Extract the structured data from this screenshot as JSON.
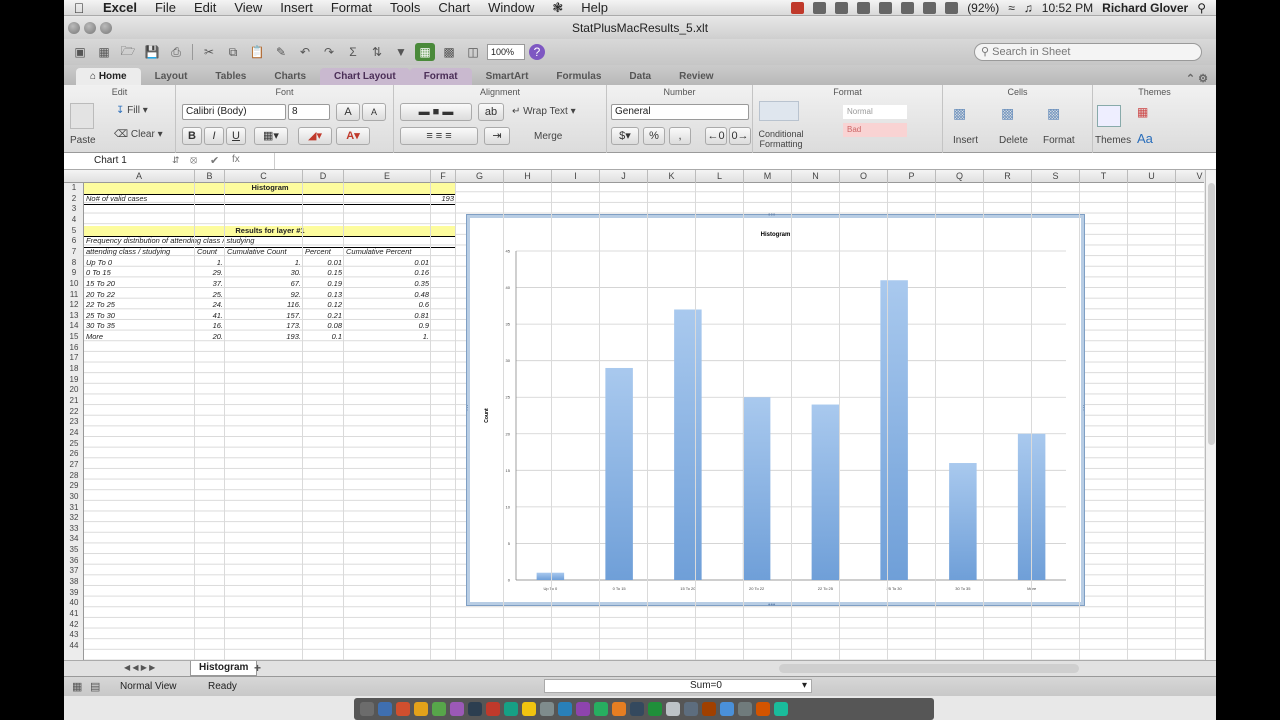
{
  "menubar": {
    "apple_icon": "apple-icon",
    "items": [
      "Excel",
      "File",
      "Edit",
      "View",
      "Insert",
      "Format",
      "Tools",
      "Chart",
      "Window",
      "Help"
    ],
    "battery": "(92%)",
    "clock": "10:52 PM",
    "user": "Richard Glover"
  },
  "window": {
    "title": "StatPlusMacResults_5.xlt"
  },
  "toolbar": {
    "zoom": "100%",
    "search_placeholder": "Search in Sheet"
  },
  "ribbon_tabs": [
    "Home",
    "Layout",
    "Tables",
    "Charts",
    "Chart Layout",
    "Format",
    "SmartArt",
    "Formulas",
    "Data",
    "Review"
  ],
  "ribbon": {
    "edit": {
      "title": "Edit",
      "fill": "Fill",
      "clear": "Clear",
      "paste": "Paste"
    },
    "font": {
      "title": "Font",
      "name": "Calibri (Body)",
      "size": "8",
      "bold": "B",
      "italic": "I",
      "underline": "U",
      "inc": "A",
      "dec": "A"
    },
    "alignment": {
      "title": "Alignment",
      "wrap": "Wrap Text",
      "merge": "Merge"
    },
    "number": {
      "title": "Number",
      "format": "General",
      "percent": "%"
    },
    "format": {
      "title": "Format",
      "conditional": "Conditional Formatting",
      "normal": "Normal",
      "bad": "Bad"
    },
    "cells": {
      "title": "Cells",
      "insert": "Insert",
      "delete": "Delete",
      "format": "Format"
    },
    "themes": {
      "title": "Themes",
      "themes": "Themes",
      "font_btn": "Aa"
    }
  },
  "formula_bar": {
    "name_box": "Chart 1",
    "fx": "fx"
  },
  "columns": [
    "A",
    "B",
    "C",
    "D",
    "E",
    "F",
    "G",
    "H",
    "I",
    "J",
    "K",
    "L",
    "M",
    "N",
    "O",
    "P",
    "Q",
    "R",
    "S",
    "T",
    "U",
    "V"
  ],
  "rows": [
    "1",
    "2",
    "3",
    "4",
    "5",
    "6",
    "7",
    "8",
    "9",
    "10",
    "11",
    "12",
    "13",
    "14",
    "15",
    "16",
    "17",
    "18",
    "19",
    "20",
    "21",
    "22",
    "23",
    "24",
    "25",
    "26",
    "27",
    "28",
    "29",
    "30",
    "31",
    "32",
    "33",
    "34",
    "35",
    "36",
    "37",
    "38",
    "39",
    "40",
    "41",
    "42",
    "43",
    "44"
  ],
  "sheet": {
    "title": "Histogram",
    "valid_label": "No# of valid cases",
    "valid_value": "193",
    "results_title": "Results for layer #1",
    "dist_title": "Frequency distribution of attending class / studying",
    "headers": [
      "attending class / studying",
      "Count",
      "Cumulative Count",
      "Percent",
      "Cumulative Percent"
    ],
    "table": [
      [
        "Up To 0",
        "1.",
        "1.",
        "0.01",
        "0.01"
      ],
      [
        "0 To 15",
        "29.",
        "30.",
        "0.15",
        "0.16"
      ],
      [
        "15 To 20",
        "37.",
        "67.",
        "0.19",
        "0.35"
      ],
      [
        "20 To 22",
        "25.",
        "92.",
        "0.13",
        "0.48"
      ],
      [
        "22 To 25",
        "24.",
        "116.",
        "0.12",
        "0.6"
      ],
      [
        "25 To 30",
        "41.",
        "157.",
        "0.21",
        "0.81"
      ],
      [
        "30 To 35",
        "16.",
        "173.",
        "0.08",
        "0.9"
      ],
      [
        "More",
        "20.",
        "193.",
        "0.1",
        "1."
      ]
    ]
  },
  "chart_data": {
    "type": "bar",
    "title": "Histogram",
    "ylabel": "Count",
    "xlabel": "",
    "categories": [
      "Up To 0",
      "0 To 15",
      "15 To 20",
      "20 To 22",
      "22 To 25",
      "25 To 30",
      "30 To 35",
      "More"
    ],
    "values": [
      1,
      29,
      37,
      25,
      24,
      41,
      16,
      20
    ],
    "ylim": [
      0,
      45
    ],
    "yticks": [
      "0",
      "5",
      "10",
      "15",
      "20",
      "25",
      "30",
      "35",
      "40",
      "45"
    ],
    "grid": true,
    "bar_color": "#a9c9ee"
  },
  "sheet_tabs": {
    "active": "Histogram",
    "add": "+"
  },
  "status": {
    "view": "Normal View",
    "ready": "Ready",
    "sum": "Sum=0"
  }
}
